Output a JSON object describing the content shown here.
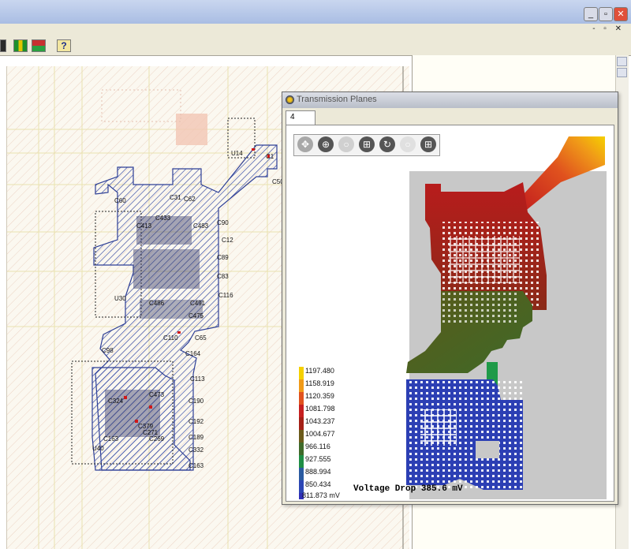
{
  "window": {
    "minimize_label": "_",
    "restore_label": "▫",
    "close_label": "✕",
    "mdi_controls": "- ▫ ✕"
  },
  "toolbar": {
    "help_label": "?"
  },
  "dialog": {
    "title": "Transmission Planes",
    "tab_label": "4",
    "footer": "Voltage Drop 385.6 mV"
  },
  "scale": {
    "labels": [
      "1197.480",
      "1158.919",
      "1120.359",
      "1081.798",
      "1043.237",
      "1004.677",
      "966.116",
      "927.555",
      "888.994",
      "850.434",
      "811.873 mV"
    ],
    "colors": [
      "#f5d000",
      "#f09a18",
      "#e0521e",
      "#c62020",
      "#a42016",
      "#6b5a1a",
      "#3f6a2a",
      "#1f8e45",
      "#2a5aa0",
      "#2c46b4",
      "#2f2fb8"
    ]
  },
  "components": [
    {
      "label": "U14"
    },
    {
      "label": "C1"
    },
    {
      "label": "C50"
    },
    {
      "label": "C60"
    },
    {
      "label": "C31"
    },
    {
      "label": "C62"
    },
    {
      "label": "C90"
    },
    {
      "label": "C12"
    },
    {
      "label": "C89"
    },
    {
      "label": "C83"
    },
    {
      "label": "C116"
    },
    {
      "label": "U30"
    },
    {
      "label": "C65"
    },
    {
      "label": "C110"
    },
    {
      "label": "C98"
    },
    {
      "label": "C164"
    },
    {
      "label": "C113"
    },
    {
      "label": "C190"
    },
    {
      "label": "C192"
    },
    {
      "label": "C189"
    },
    {
      "label": "C332"
    },
    {
      "label": "C163"
    },
    {
      "label": "U40"
    },
    {
      "label": "C163"
    },
    {
      "label": "C473"
    },
    {
      "label": "C269"
    },
    {
      "label": "C271"
    },
    {
      "label": "C379"
    },
    {
      "label": "C324"
    },
    {
      "label": "C486"
    },
    {
      "label": "C491"
    },
    {
      "label": "C475"
    },
    {
      "label": "C413"
    },
    {
      "label": "C483"
    },
    {
      "label": "C433"
    }
  ]
}
